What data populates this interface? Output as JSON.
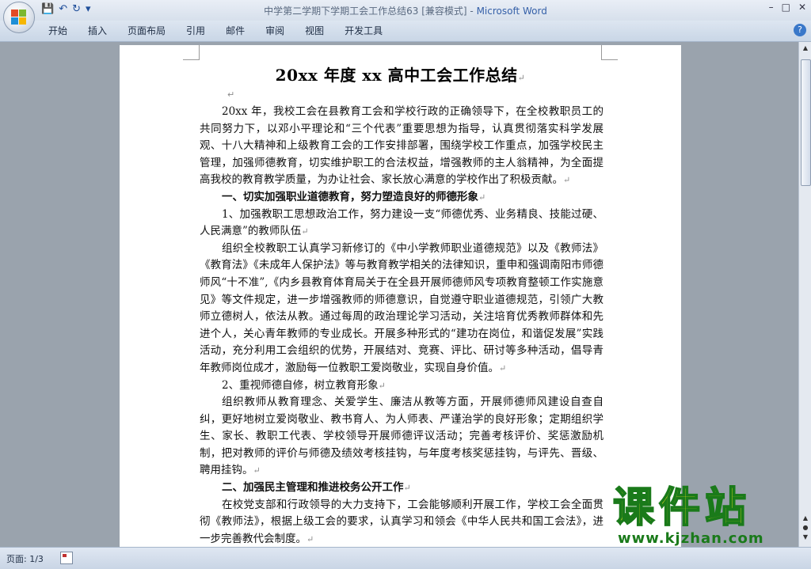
{
  "window": {
    "title": "中学第二学期下学期工会工作总结63 [兼容模式]",
    "app_name": "Microsoft Word",
    "controls": [
      "–",
      "□",
      "✕"
    ]
  },
  "quick_access": {
    "save_icon": "💾",
    "undo_icon": "↶",
    "redo_icon": "↻",
    "more": "▾"
  },
  "ribbon": {
    "tabs": [
      "开始",
      "插入",
      "页面布局",
      "引用",
      "邮件",
      "审阅",
      "视图",
      "开发工具"
    ],
    "help": "?"
  },
  "document": {
    "title": "20xx 年度 xx 高中工会工作总结",
    "paragraph_mark": "↵",
    "paragraphs": [
      {
        "type": "p",
        "text": "20xx 年，我校工会在县教育工会和学校行政的正确领导下，在全校教职员工的共同努力下，以邓小平理论和“三个代表”重要思想为指导，认真贯彻落实科学发展观、十八大精神和上级教育工会的工作安排部署，围绕学校工作重点，加强学校民主管理，加强师德教育，切实维护职工的合法权益，增强教师的主人翁精神，为全面提高我校的教育教学质量，为办让社会、家长放心满意的学校作出了积极贡献。"
      },
      {
        "type": "h",
        "text": "一、切实加强职业道德教育，努力塑造良好的师德形象"
      },
      {
        "type": "p",
        "text": "1、加强教职工思想政治工作，努力建设一支“师德优秀、业务精良、技能过硬、人民满意”的教师队伍"
      },
      {
        "type": "p",
        "text": "组织全校教职工认真学习新修订的《中小学教师职业道德规范》以及《教师法》《教育法》《未成年人保护法》等与教育教学相关的法律知识，重申和强调南阳市师德师风“十不准”,《内乡县教育体育局关于在全县开展师德师风专项教育整顿工作实施意见》等文件规定，进一步增强教师的师德意识，自觉遵守职业道德规范，引领广大教师立德树人，依法从教。通过每周的政治理论学习活动，关注培育优秀教师群体和先进个人，关心青年教师的专业成长。开展多种形式的“建功在岗位，和谐促发展”实践活动，充分利用工会组织的优势，开展结对、竞赛、评比、研讨等多种活动，倡导青年教师岗位成才，激励每一位教职工爱岗敬业，实现自身价值。"
      },
      {
        "type": "p",
        "text": "2、重视师德自修，树立教育形象"
      },
      {
        "type": "p",
        "text": "组织教师从教育理念、关爱学生、廉洁从教等方面，开展师德师风建设自查自纠，更好地树立爱岗敬业、教书育人、为人师表、严谨治学的良好形象；定期组织学生、家长、教职工代表、学校领导开展师德评议活动；完善考核评价、奖惩激励机制，把对教师的评价与师德及绩效考核挂钩，与年度考核奖惩挂钩，与评先、晋级、聘用挂钩。"
      },
      {
        "type": "h",
        "text": "二、加强民主管理和推进校务公开工作"
      },
      {
        "type": "p",
        "text": "在校党支部和行政领导的大力支持下，工会能够顺利开展工作，学校工会全面贯彻《教师法》，根据上级工会的要求，认真学习和领会《中华人民共和国工会法》，进一步完善教代会制度。"
      }
    ]
  },
  "status_bar": {
    "page": "页面: 1/3"
  },
  "watermark": {
    "title": "课件站",
    "url": "www.kjzhan.com"
  }
}
